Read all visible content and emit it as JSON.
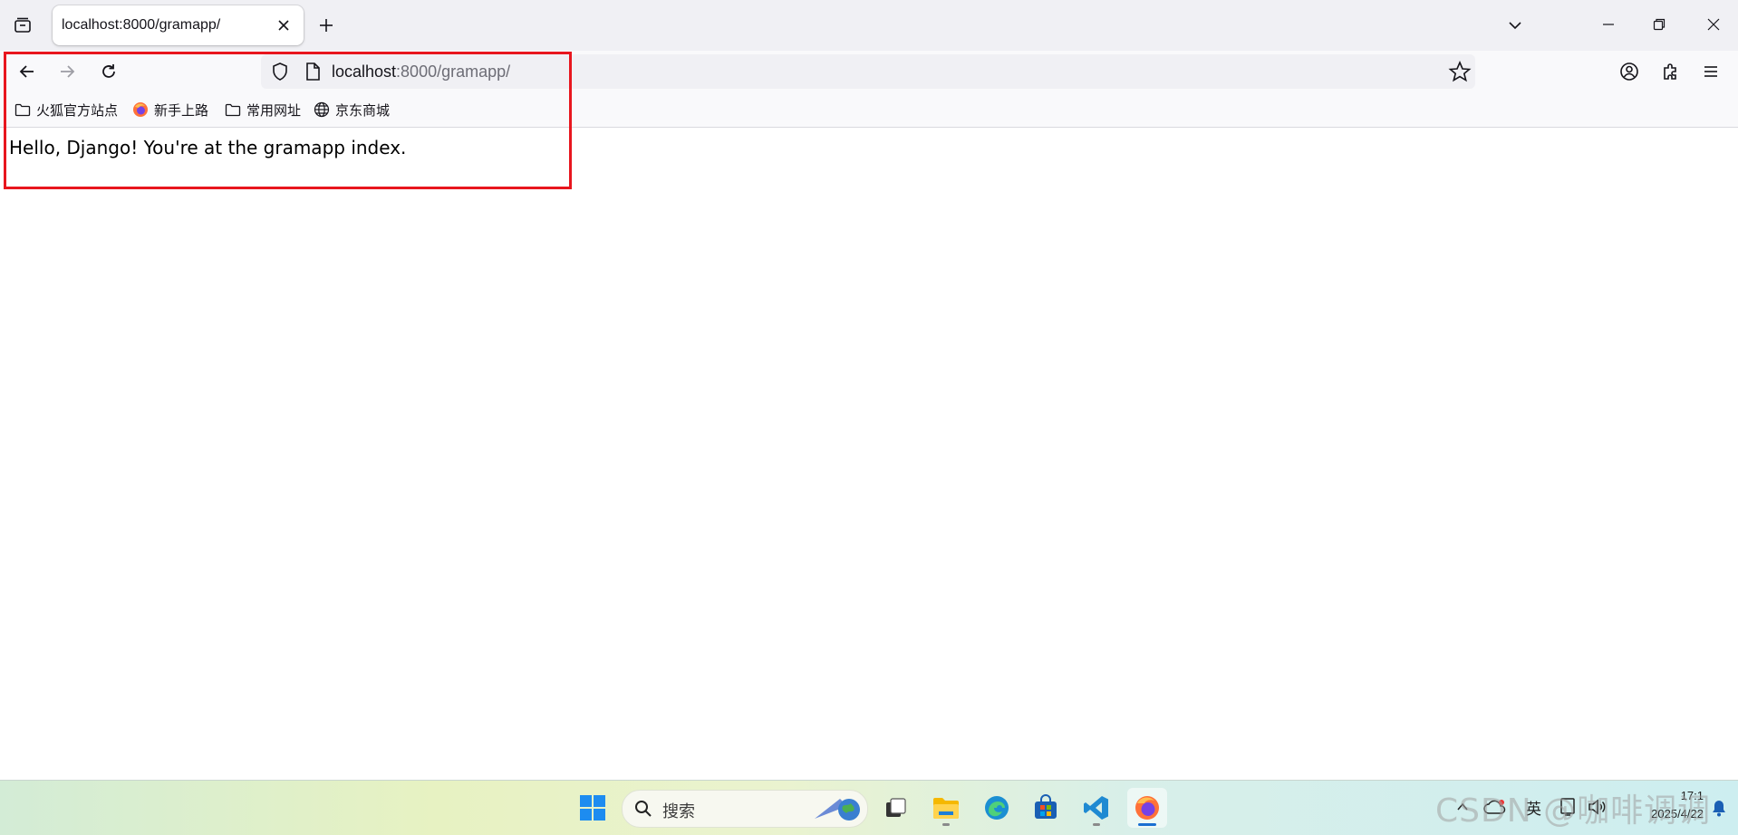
{
  "browser": {
    "tab": {
      "title": "localhost:8000/gramapp/"
    },
    "address": {
      "host": "localhost",
      "rest": ":8000/gramapp/"
    },
    "bookmarks": [
      {
        "label": "火狐官方站点",
        "icon": "folder-icon"
      },
      {
        "label": "新手上路",
        "icon": "firefox-icon"
      },
      {
        "label": "常用网址",
        "icon": "folder-icon"
      },
      {
        "label": "京东商城",
        "icon": "globe-icon"
      }
    ]
  },
  "page": {
    "text": "Hello, Django! You're at the gramapp index."
  },
  "taskbar": {
    "search_label": "搜索",
    "tray_lang": "英",
    "time": "17:1",
    "date": "2025/4/22"
  },
  "watermark": "CSDN @咖啡调调",
  "colors": {
    "highlight": "#e8161e",
    "firefox_running": "#1a6fd1"
  }
}
